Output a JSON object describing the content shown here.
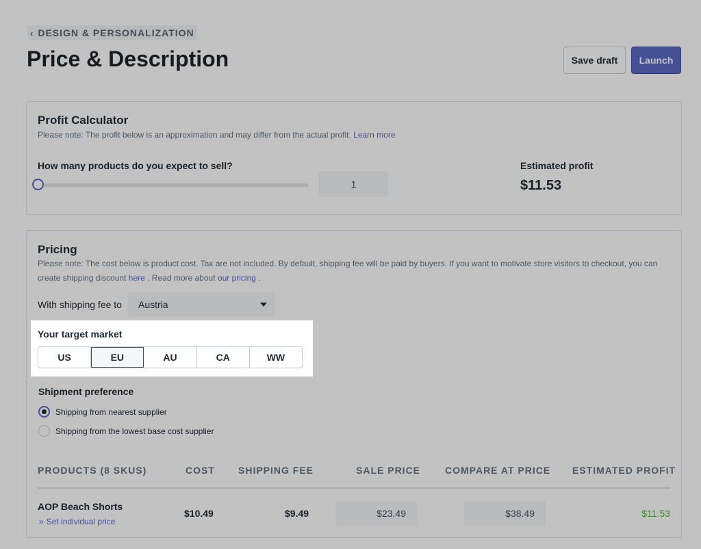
{
  "header": {
    "breadcrumb": "DESIGN & PERSONALIZATION",
    "title": "Price & Description",
    "save_draft": "Save draft",
    "launch": "Launch"
  },
  "profit_calculator": {
    "title": "Profit Calculator",
    "note": "Please note: The profit below is an approximation and may differ from the actual profit.",
    "learn_more": "Learn more",
    "question": "How many products do you expect to sell?",
    "quantity": "1",
    "slider_fraction": 0,
    "estimated_profit_label": "Estimated profit",
    "estimated_profit_value": "$11.53"
  },
  "pricing": {
    "title": "Pricing",
    "note_part1": "Please note: The cost below is product cost. Tax are not included. By default, shipping fee will be paid by buyers. If you want to motivate store visitors to checkout, you can create shipping discount",
    "note_here": "here",
    "note_part2": ". Read more about",
    "note_link": "our pricing",
    "note_end": ".",
    "shipping_fee_label": "With shipping fee to",
    "shipping_country": "Austria",
    "target_market_label": "Your target market",
    "markets": [
      "US",
      "EU",
      "AU",
      "CA",
      "WW"
    ],
    "selected_market": "EU",
    "shipment_preference_label": "Shipment preference",
    "shipment_options": [
      "Shipping from nearest supplier",
      "Shipping from the lowest base cost supplier"
    ],
    "selected_shipment": 0,
    "table": {
      "headers": [
        "PRODUCTS (8 SKUS)",
        "COST",
        "SHIPPING FEE",
        "SALE PRICE",
        "COMPARE AT PRICE",
        "ESTIMATED PROFIT"
      ],
      "rows": [
        {
          "name": "AOP Beach Shorts",
          "link": "Set individual price",
          "cost": "$10.49",
          "shipping_fee": "$9.49",
          "sale_price": "$23.49",
          "compare_at_price": "$38.49",
          "estimated_profit": "$11.53"
        }
      ]
    }
  },
  "colors": {
    "accent": "#5c6ac4",
    "profit_green": "#50b83c"
  }
}
